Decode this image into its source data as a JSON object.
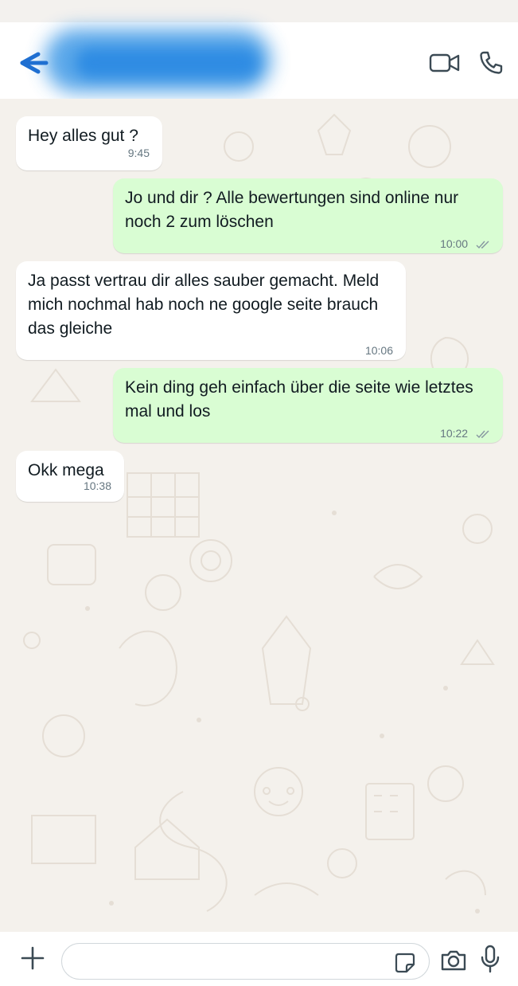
{
  "header": {
    "contact_name": ""
  },
  "messages": [
    {
      "direction": "in",
      "text": "Hey alles gut ?",
      "time": "9:45"
    },
    {
      "direction": "out",
      "text": "Jo und dir ? Alle bewertungen sind online nur noch 2 zum löschen",
      "time": "10:00"
    },
    {
      "direction": "in",
      "text": "Ja passt vertrau dir alles sauber gemacht. Meld mich nochmal hab noch ne google seite brauch das gleiche",
      "time": "10:06"
    },
    {
      "direction": "out",
      "text": "Kein ding geh einfach über die seite wie letztes mal und los",
      "time": "10:22"
    },
    {
      "direction": "in",
      "text": "Okk mega",
      "time": "10:38"
    }
  ],
  "composer": {
    "value": "",
    "placeholder": ""
  },
  "icons": [
    "back-arrow-icon",
    "video-camera-icon",
    "phone-icon",
    "plus-icon",
    "sticker-icon",
    "camera-icon",
    "microphone-icon",
    "double-check-icon"
  ],
  "colors": {
    "incoming_bubble": "#ffffff",
    "outgoing_bubble": "#d9fdd3",
    "wallpaper": "#f4f1ec",
    "read_ticks": "#8696a0",
    "accent": "#2f8ce3"
  }
}
